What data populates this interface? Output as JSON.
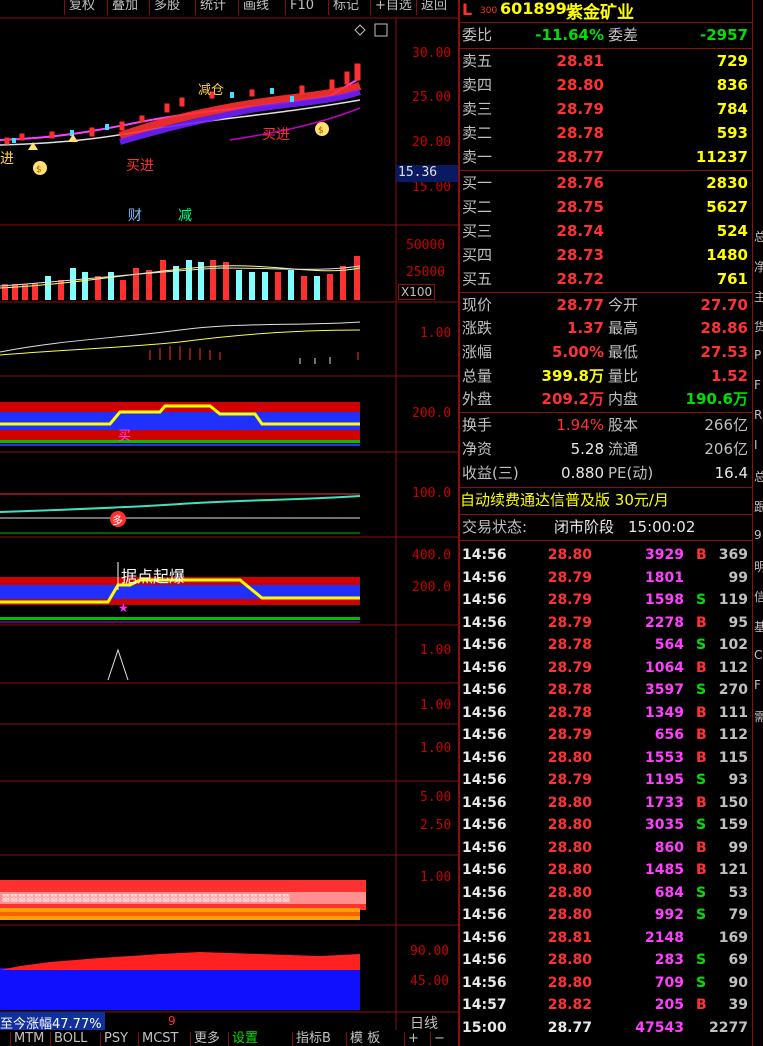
{
  "toolbar": {
    "buttons": [
      "复权",
      "叠加",
      "多股",
      "统计",
      "画线",
      "F10",
      "标记",
      "+自选",
      "返回"
    ]
  },
  "chart": {
    "axis_labels": {
      "price": [
        "30.00",
        "25.00",
        "20.00",
        "15.00"
      ],
      "price_marker": "15.36",
      "vol": [
        "50000",
        "25000"
      ],
      "vol_unit": "X100",
      "p3": "1.00",
      "p4": "200.0",
      "p5": "100.0",
      "p6_top": "400.0",
      "p6_mid": "200.0",
      "p7": "1.00",
      "p8": "1.00",
      "p9": "1.00",
      "p10_top": "5.00",
      "p10_mid": "2.50",
      "p11": "1.00",
      "p12_top": "90.00",
      "p12_mid": "45.00"
    },
    "annotations": {
      "jin": "进",
      "buy_in": "买进",
      "buy_in2": "买进",
      "cai": "财",
      "jian": "减",
      "mai": "买",
      "duo": "多",
      "break_text": "据点起爆",
      "reduce": "减仓",
      "gain_label": "至今涨幅47.77%"
    },
    "bottom_tabs": [
      "MTM",
      "BOLL",
      "PSY",
      "MCST",
      "更多",
      "设置",
      "指标B",
      "模 板"
    ],
    "bottom_right": [
      "日线",
      "+",
      "−"
    ],
    "nine": "9"
  },
  "quote": {
    "level": "L",
    "code_tag": "300",
    "code": "601899",
    "name": "紫金矿业",
    "weibi_label": "委比",
    "weibi": "-11.64%",
    "weicha_label": "委差",
    "weicha": "-2957",
    "asks": [
      {
        "label": "卖五",
        "price": "28.81",
        "vol": "729"
      },
      {
        "label": "卖四",
        "price": "28.80",
        "vol": "836"
      },
      {
        "label": "卖三",
        "price": "28.79",
        "vol": "784"
      },
      {
        "label": "卖二",
        "price": "28.78",
        "vol": "593"
      },
      {
        "label": "卖一",
        "price": "28.77",
        "vol": "11237"
      }
    ],
    "bids": [
      {
        "label": "买一",
        "price": "28.76",
        "vol": "2830"
      },
      {
        "label": "买二",
        "price": "28.75",
        "vol": "5627"
      },
      {
        "label": "买三",
        "price": "28.74",
        "vol": "524"
      },
      {
        "label": "买四",
        "price": "28.73",
        "vol": "1480"
      },
      {
        "label": "买五",
        "price": "28.72",
        "vol": "761"
      }
    ],
    "stats": [
      {
        "l1": "现价",
        "v1": "28.77",
        "c1": "red",
        "l2": "今开",
        "v2": "27.70",
        "c2": "red"
      },
      {
        "l1": "涨跌",
        "v1": "1.37",
        "c1": "red",
        "l2": "最高",
        "v2": "28.86",
        "c2": "red"
      },
      {
        "l1": "涨幅",
        "v1": "5.00%",
        "c1": "red",
        "l2": "最低",
        "v2": "27.53",
        "c2": "red"
      },
      {
        "l1": "总量",
        "v1": "399.8万",
        "c1": "yellow",
        "l2": "量比",
        "v2": "1.52",
        "c2": "red"
      },
      {
        "l1": "外盘",
        "v1": "209.2万",
        "c1": "red",
        "l2": "内盘",
        "v2": "190.6万",
        "c2": "green"
      }
    ],
    "fin": [
      {
        "l1": "换手",
        "v1": "1.94%",
        "l2": "股本",
        "v2": "266亿"
      },
      {
        "l1": "净资",
        "v1": "5.28",
        "l2": "流通",
        "v2": "206亿"
      },
      {
        "l1": "收益(三)",
        "v1": "0.880",
        "l2": "PE(动)",
        "v2": "16.4"
      }
    ],
    "promo": "自动续费通达信普及版 30元/月",
    "status_label": "交易状态:",
    "status_value": "闭市阶段",
    "status_time": "15:00:02"
  },
  "ticks": [
    {
      "t": "14:56",
      "p": "28.80",
      "v": "3929",
      "s": "B",
      "n": "369"
    },
    {
      "t": "14:56",
      "p": "28.79",
      "v": "1801",
      "s": "",
      "n": "99"
    },
    {
      "t": "14:56",
      "p": "28.79",
      "v": "1598",
      "s": "S",
      "n": "119"
    },
    {
      "t": "14:56",
      "p": "28.79",
      "v": "2278",
      "s": "B",
      "n": "95"
    },
    {
      "t": "14:56",
      "p": "28.78",
      "v": "564",
      "s": "S",
      "n": "102"
    },
    {
      "t": "14:56",
      "p": "28.79",
      "v": "1064",
      "s": "B",
      "n": "112"
    },
    {
      "t": "14:56",
      "p": "28.78",
      "v": "3597",
      "s": "S",
      "n": "270"
    },
    {
      "t": "14:56",
      "p": "28.78",
      "v": "1349",
      "s": "B",
      "n": "111"
    },
    {
      "t": "14:56",
      "p": "28.79",
      "v": "656",
      "s": "B",
      "n": "112"
    },
    {
      "t": "14:56",
      "p": "28.80",
      "v": "1553",
      "s": "B",
      "n": "115"
    },
    {
      "t": "14:56",
      "p": "28.79",
      "v": "1195",
      "s": "S",
      "n": "93"
    },
    {
      "t": "14:56",
      "p": "28.80",
      "v": "1733",
      "s": "B",
      "n": "150"
    },
    {
      "t": "14:56",
      "p": "28.80",
      "v": "3035",
      "s": "S",
      "n": "159"
    },
    {
      "t": "14:56",
      "p": "28.80",
      "v": "860",
      "s": "B",
      "n": "99"
    },
    {
      "t": "14:56",
      "p": "28.80",
      "v": "1485",
      "s": "B",
      "n": "121"
    },
    {
      "t": "14:56",
      "p": "28.80",
      "v": "684",
      "s": "S",
      "n": "53"
    },
    {
      "t": "14:56",
      "p": "28.80",
      "v": "992",
      "s": "S",
      "n": "79"
    },
    {
      "t": "14:56",
      "p": "28.81",
      "v": "2148",
      "s": "",
      "n": "169"
    },
    {
      "t": "14:56",
      "p": "28.80",
      "v": "283",
      "s": "S",
      "n": "69"
    },
    {
      "t": "14:56",
      "p": "28.80",
      "v": "709",
      "s": "S",
      "n": "90"
    },
    {
      "t": "14:57",
      "p": "28.82",
      "v": "205",
      "s": "B",
      "n": "39"
    },
    {
      "t": "15:00",
      "p": "28.77",
      "v": "47543",
      "s": "",
      "n": "2277"
    }
  ],
  "edge_chars": [
    "总",
    "净",
    "主",
    "货",
    "P",
    "F",
    "R",
    "I",
    "总",
    "跟",
    "9",
    "明",
    "信",
    "基",
    "C",
    "F",
    "需"
  ]
}
